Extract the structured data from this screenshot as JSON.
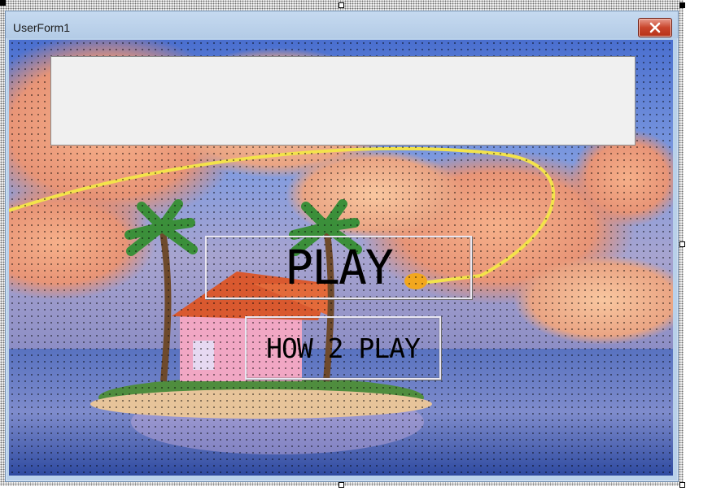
{
  "window": {
    "title": "UserForm1",
    "close_icon": "close-icon"
  },
  "form": {
    "text_box_value": "",
    "play_label": "PLAY",
    "how_to_play_label": "HOW 2 PLAY",
    "background_image": "tropical island with pink house and palm trees at sunset"
  },
  "colors": {
    "titlebar": "#b9d1ea",
    "close_button": "#c9452c",
    "text_box": "#f0f0f0"
  }
}
